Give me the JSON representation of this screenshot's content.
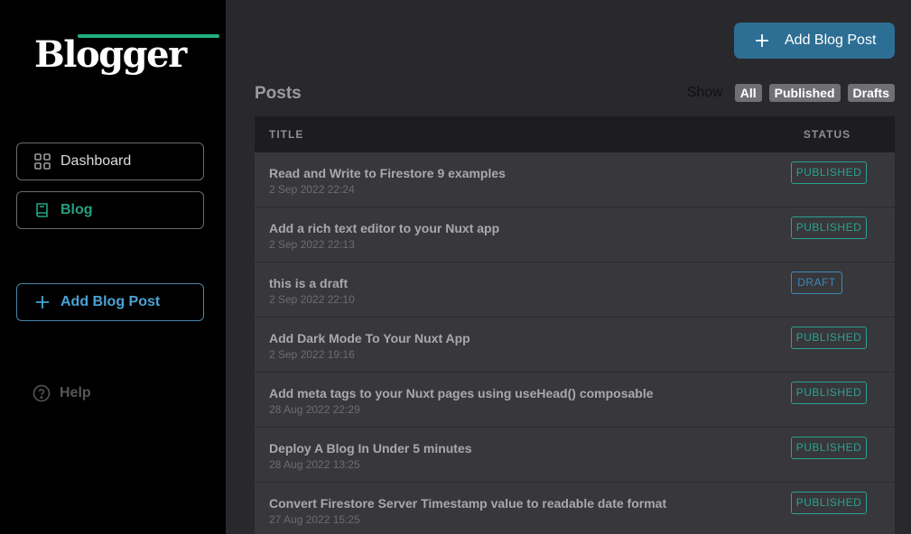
{
  "sidebar": {
    "logo_text": "Blogger",
    "nav": {
      "dashboard_label": "Dashboard",
      "blog_label": "Blog",
      "add_label": "Add Blog Post",
      "help_label": "Help"
    }
  },
  "main": {
    "add_button_label": "Add Blog Post",
    "posts_heading": "Posts",
    "filters": {
      "show_label": "Show",
      "all_label": "All",
      "published_label": "Published",
      "drafts_label": "Drafts"
    },
    "table": {
      "headers": {
        "title": "TITLE",
        "status": "STATUS"
      },
      "rows": [
        {
          "title": "Read and Write to Firestore 9 examples",
          "date": "2 Sep 2022 22:24",
          "status": "PUBLISHED"
        },
        {
          "title": "Add a rich text editor to your Nuxt app",
          "date": "2 Sep 2022 22:13",
          "status": "PUBLISHED"
        },
        {
          "title": "this is a draft",
          "date": "2 Sep 2022 22:10",
          "status": "DRAFT"
        },
        {
          "title": "Add Dark Mode To Your Nuxt App",
          "date": "2 Sep 2022 19:16",
          "status": "PUBLISHED"
        },
        {
          "title": "Add meta tags to your Nuxt pages using useHead() composable",
          "date": "28 Aug 2022 22:29",
          "status": "PUBLISHED"
        },
        {
          "title": "Deploy A Blog In Under 5 minutes",
          "date": "28 Aug 2022 13:25",
          "status": "PUBLISHED"
        },
        {
          "title": "Convert Firestore Server Timestamp value to readable date format",
          "date": "27 Aug 2022 15:25",
          "status": "PUBLISHED"
        }
      ]
    }
  },
  "colors": {
    "accent_green": "#2aa38e",
    "accent_blue": "#2d6f94",
    "draft_blue": "#3c8ab5"
  },
  "icons": {
    "dashboard": "grid-icon",
    "blog": "book-icon",
    "add": "plus-icon",
    "help": "help-circle-icon"
  }
}
